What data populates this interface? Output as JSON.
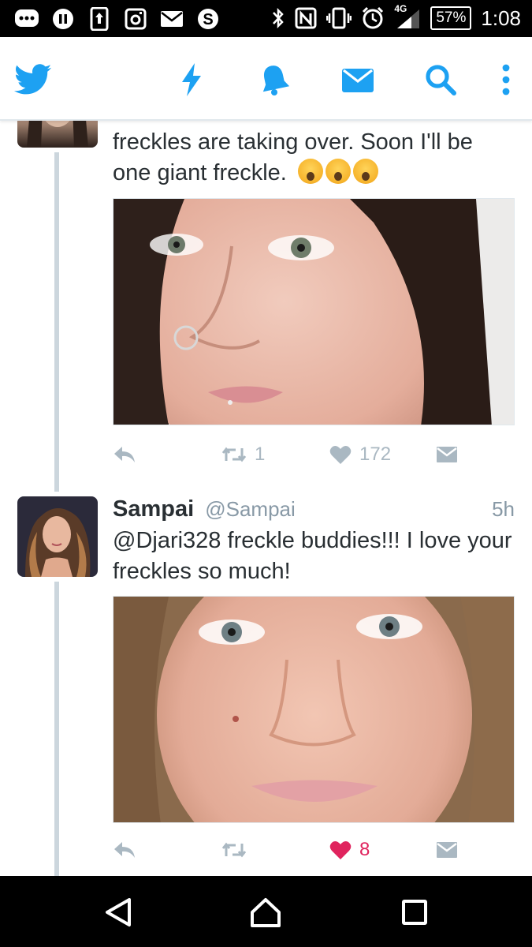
{
  "status_bar": {
    "network": "4G",
    "battery": "57%",
    "time": "1:08"
  },
  "app_bar": {
    "app": "Twitter",
    "icons": [
      "twitter-bird-icon",
      "lightning-icon",
      "bell-icon",
      "envelope-icon",
      "search-icon",
      "overflow-menu-icon"
    ]
  },
  "colors": {
    "brand": "#1da1f2",
    "text": "#292f33",
    "muted": "#8899a6",
    "action": "#aab8c2",
    "like": "#e0245e"
  },
  "tweets": [
    {
      "text_line1": "freckles are taking over. Soon I'll be",
      "text_line2": "one giant freckle.",
      "emojis": [
        "face-screaming-emoji",
        "face-screaming-emoji",
        "face-screaming-emoji"
      ],
      "retweets": "1",
      "likes": "172",
      "liked": false
    },
    {
      "name": "Sampai",
      "handle": "@Sampai",
      "time": "5h",
      "mention": "@Djari328",
      "text_line1_rest": " freckle buddies!!! I love your",
      "text_line2": "freckles so much!",
      "retweets": "",
      "likes": "8",
      "liked": true
    }
  ]
}
